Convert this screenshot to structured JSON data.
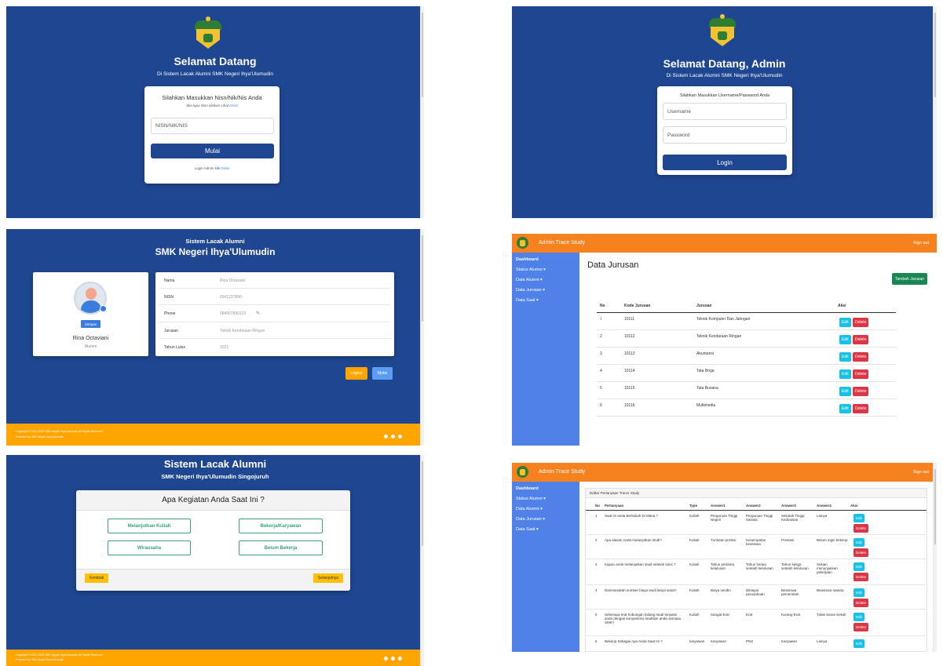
{
  "p1": {
    "title": "Selamat Datang",
    "subtitle": "Di Sistem Lacak Alumni SMK Negeri Ihya'Ulumudin",
    "card_title": "Silahkan Masukkan Nisn/Nik/Nis Anda",
    "hint_prefix": "Jika lupa Nisn silakan Lihat ",
    "hint_link": "Disini",
    "input_placeholder": "NISN/NIK/NIS",
    "button": "Mulai",
    "admin_prefix": "Login Admin klik ",
    "admin_link": "Disini"
  },
  "p2": {
    "title": "Selamat Datang, Admin",
    "subtitle": "Di Sistem Lacak Alumni SMK Negeri Ihya'Ulumudin",
    "card_title": "Silahkan Masukkan Username/Password Anda",
    "username_placeholder": "Username",
    "password_placeholder": "Password",
    "button": "Login"
  },
  "p3": {
    "title": "Sistem Lacak Alumni",
    "subtitle": "SMK Negeri Ihya'Ulumudin",
    "save_button": "Simpan",
    "name": "Rina Octaviani",
    "role": "Alumni",
    "rows": [
      {
        "label": "Nama",
        "value": "Rina Octaviani"
      },
      {
        "label": "NISN",
        "value": "6541237890"
      },
      {
        "label": "Phone",
        "value": "084567890123"
      },
      {
        "label": "Jurusan",
        "value": "Teknik Kendaraan Ringan"
      },
      {
        "label": "Tahun Lulus",
        "value": "2021"
      }
    ],
    "logout_button": "Logout",
    "start_button": "Mulai",
    "footer_line1": "Copyright © 2021-2022 SMK Negeri Ihya'Ulumudin All Rights Reserved",
    "footer_line2": "Powered by SMK Negeri Ihya'Ulumudin"
  },
  "p4": {
    "brand": "Admin Trace Study",
    "signout": "Sign out",
    "sidebar": [
      "Dashboard",
      "Status Alumni ▾",
      "Data Alumni ▾",
      "Data Jurusan ▾",
      "Data Saat ▾"
    ],
    "page_title": "Data Jurusan",
    "add_button": "Tambah Jurusan",
    "headers": [
      "No",
      "Kode Jurusan",
      "Jurusan",
      "Aksi"
    ],
    "rows": [
      {
        "no": "1",
        "kode": "10111",
        "jurusan": "Teknik Komputer Dan Jaringan"
      },
      {
        "no": "2",
        "kode": "10112",
        "jurusan": "Teknik Kendaraan Ringan"
      },
      {
        "no": "3",
        "kode": "10113",
        "jurusan": "Akuntansi"
      },
      {
        "no": "4",
        "kode": "10114",
        "jurusan": "Tata Boga"
      },
      {
        "no": "5",
        "kode": "10115",
        "jurusan": "Tata Busana"
      },
      {
        "no": "6",
        "kode": "10116",
        "jurusan": "Multimedia"
      }
    ],
    "edit_label": "Edit",
    "delete_label": "Delete"
  },
  "p5": {
    "title": "Sistem Lacak Alumni",
    "subtitle": "SMK Negeri Ihya'Ulumudin Singojuruh",
    "question": "Apa Kegiatan Anda Saat Ini ?",
    "options": [
      "Melanjutkan Kuliah",
      "Bekerja/Karyawan",
      "Wirausaha",
      "Belum Bekerja"
    ],
    "back_button": "Kembali",
    "next_button": "Selanjutnya",
    "footer_line1": "Copyright © 2021-2022 SMK Negeri Ihya'Ulumudin All Rights Reserved",
    "footer_line2": "Powered by SMK Negeri Ihya'Ulumudin"
  },
  "p6": {
    "brand": "Admin Trace Study",
    "signout": "Sign out",
    "sidebar": [
      "Dashboard",
      "Status Alumni ▾",
      "Data Alumni ▾",
      "Data Jurusan ▾",
      "Data Saat ▾"
    ],
    "table_title": "Daftar Pertanyaan Tracer Study",
    "headers": [
      "No",
      "Pertanyaan",
      "Type",
      "Answer1",
      "Answer2",
      "Answer3",
      "Answer4",
      "Aksi"
    ],
    "rows": [
      {
        "no": "1",
        "q": "Saat ini anda Berkuliah Di Mana ?",
        "type": "Kuliah",
        "a1": "Perguruan Tinggi Negeri",
        "a2": "Perguruan Tinggi Swasta",
        "a3": "Sekolah Tinggi Kedinasan",
        "a4": "Lainya"
      },
      {
        "no": "2",
        "q": "Apa alasan Anda melanjutkan studi?",
        "type": "Kuliah",
        "a1": "Tuntutan profesi",
        "a2": "Kesempatan beasiswa",
        "a3": "Prestasi",
        "a4": "Belum ingin bekerja"
      },
      {
        "no": "3",
        "q": "Kapan anda melanjutkan studi setelah lulus ?",
        "type": "Kuliah",
        "a1": "Tahun pertama kelulusan",
        "a2": "Tahun kedua setelah kelulusan",
        "a3": "Tahun ketiga setelah kelulusan",
        "a4": "Sekian menunjukkan pekerjaan"
      },
      {
        "no": "4",
        "q": "Darimanakah sumber biaya studi lanjut anda?",
        "type": "Kuliah",
        "a1": "Biaya sendiri",
        "a2": "Dibiayai perusahaan",
        "a3": "Beasiswa pemerintah",
        "a4": "Beasiswa swasta"
      },
      {
        "no": "5",
        "q": "Seberapa erat hubungan bidang studi lanjutan anda dengan kompetensi keahlian anda semasa SMK?",
        "type": "Kuliah",
        "a1": "Sangat Erat",
        "a2": "Erat",
        "a3": "Kurang Erat",
        "a4": "Tidak Sama Sekali"
      },
      {
        "no": "6",
        "q": "Bekerja Sebagai Apa Anda Saat Ini ?",
        "type": "karyawan",
        "a1": "Karyawan",
        "a2": "PNS",
        "a3": "Karyawan",
        "a4": "Lainya"
      }
    ],
    "edit_label": "Edit",
    "delete_label": "Delete"
  }
}
